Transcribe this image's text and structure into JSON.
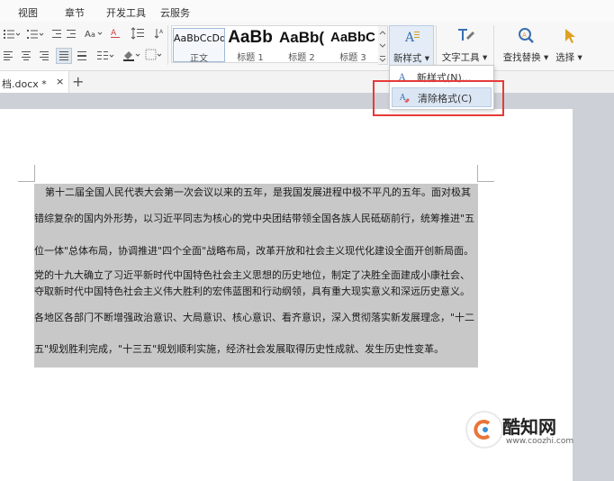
{
  "menu": {
    "tabs": [
      "视图",
      "章节",
      "开发工具",
      "云服务"
    ]
  },
  "ribbon": {
    "styles": [
      {
        "preview": "AaBbCcDd",
        "label": "正文"
      },
      {
        "preview": "AaBb",
        "label": "标题 1"
      },
      {
        "preview": "AaBb(",
        "label": "标题 2"
      },
      {
        "preview": "AaBbC",
        "label": "标题 3"
      }
    ],
    "new_style": "新样式",
    "text_tools": "文字工具",
    "find_replace": "查找替换",
    "select": "选择"
  },
  "dropdown": {
    "new_style": "新样式(N)...",
    "clear_format": "清除格式(C)"
  },
  "doc_tab": {
    "name": "档.docx *",
    "close": "×",
    "add": "+"
  },
  "doc": {
    "lines": [
      "第十二届全国人民代表大会第一次会议以来的五年，是我国发展进程中极不平凡的五年。面对极其",
      "错综复杂的国内外形势，以习近平同志为核心的党中央团结带领全国各族人民砥砺前行，统筹推进\"五",
      "位一体\"总体布局，协调推进\"四个全面\"战略布局，改革开放和社会主义现代化建设全面开创新局面。",
      "党的十九大确立了习近平新时代中国特色社会主义思想的历史地位，制定了决胜全面建成小康社会、",
      "夺取新时代中国特色社会主义伟大胜利的宏伟蓝图和行动纲领，具有重大现实意义和深远历史意义。",
      "各地区各部门不断增强政治意识、大局意识、核心意识、看齐意识，深入贯彻落实新发展理念，\"十二",
      "五\"规划胜利完成，\"十三五\"规划顺利实施，经济社会发展取得历史性成就、发生历史性变革。"
    ]
  },
  "watermark": {
    "brand": "酷知网",
    "url": "www.coozhi.com"
  },
  "colors": {
    "annotation": "#e63a3a",
    "selection": "#c8c8c8",
    "hover": "#dbe6f4"
  }
}
